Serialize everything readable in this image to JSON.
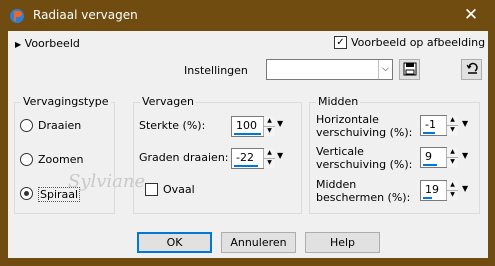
{
  "window": {
    "title": "Radiaal vervagen",
    "close_glyph": "✕"
  },
  "toolbar": {
    "preview_label": "Voorbeeld",
    "preview_on_image_label": "Voorbeeld op afbeelding",
    "preview_on_image_checked": true,
    "settings_label": "Instellingen",
    "settings_value": ""
  },
  "type_group": {
    "title": "Vervagingstype",
    "options": [
      {
        "label": "Draaien",
        "selected": false
      },
      {
        "label": "Zoomen",
        "selected": false
      },
      {
        "label": "Spiraal",
        "selected": true
      }
    ]
  },
  "blur_group": {
    "title": "Vervagen",
    "strength_label": "Sterkte (%):",
    "strength_value": "100",
    "twist_label": "Graden draaien:",
    "twist_value": "-22",
    "oval_label": "Ovaal",
    "oval_checked": false
  },
  "center_group": {
    "title": "Midden",
    "h_label_1": "Horizontale",
    "h_label_2": "verschuiving (%):",
    "h_value": "-1",
    "v_label_1": "Verticale",
    "v_label_2": "verschuiving (%):",
    "v_value": "9",
    "p_label_1": "Midden",
    "p_label_2": "beschermen (%):",
    "p_value": "19"
  },
  "buttons": {
    "ok": "OK",
    "cancel": "Annuleren",
    "help": "Help"
  },
  "watermark": "Sylviane",
  "colors": {
    "titlebar": "#704c10",
    "accent": "#0078d7"
  }
}
